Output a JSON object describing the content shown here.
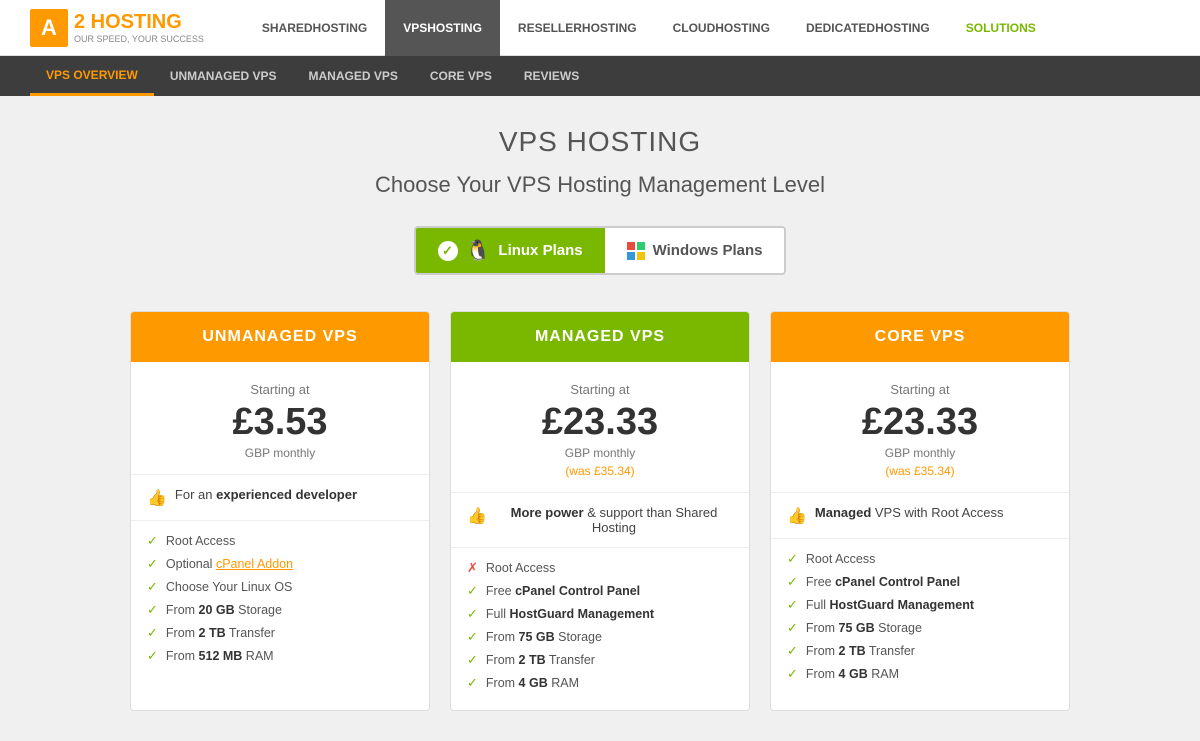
{
  "logo": {
    "letter": "A",
    "brand": "2 HOSTING",
    "tagline": "OUR SPEED, YOUR SUCCESS"
  },
  "main_nav": [
    {
      "label": "SHARED",
      "line2": "HOSTING",
      "active": false
    },
    {
      "label": "VPS",
      "line2": "HOSTING",
      "active": true
    },
    {
      "label": "RESELLER",
      "line2": "HOSTING",
      "active": false
    },
    {
      "label": "CLOUD",
      "line2": "HOSTING",
      "active": false
    },
    {
      "label": "DEDICATED",
      "line2": "HOSTING",
      "active": false
    },
    {
      "label": "SOLUTIONS",
      "line2": "",
      "active": false,
      "green": true
    }
  ],
  "sub_nav": [
    {
      "label": "VPS OVERVIEW",
      "active": true
    },
    {
      "label": "UNMANAGED VPS",
      "active": false
    },
    {
      "label": "MANAGED VPS",
      "active": false
    },
    {
      "label": "CORE VPS",
      "active": false
    },
    {
      "label": "REVIEWS",
      "active": false
    }
  ],
  "page": {
    "title": "VPS HOSTING",
    "subtitle": "Choose Your VPS Hosting Management Level"
  },
  "toggle": {
    "linux_label": "Linux Plans",
    "windows_label": "Windows Plans",
    "linux_active": true
  },
  "plans": [
    {
      "name": "UNMANAGED VPS",
      "header_class": "header-yellow",
      "starting_at": "Starting at",
      "price": "£3.53",
      "period": "GBP monthly",
      "was": null,
      "highlight": "For an experienced developer",
      "features": [
        {
          "icon": "check",
          "text": "Root Access",
          "bold": false
        },
        {
          "icon": "check",
          "text": "Optional ",
          "bold_part": "cPanel Addon",
          "rest": ""
        },
        {
          "icon": "check",
          "text": "Choose Your Linux OS",
          "bold": false
        },
        {
          "icon": "check",
          "text": "From ",
          "bold_part": "20 GB",
          "rest": " Storage"
        },
        {
          "icon": "check",
          "text": "From ",
          "bold_part": "2 TB",
          "rest": " Transfer"
        },
        {
          "icon": "check",
          "text": "From ",
          "bold_part": "512 MB",
          "rest": " RAM"
        }
      ]
    },
    {
      "name": "MANAGED VPS",
      "header_class": "header-green",
      "starting_at": "Starting at",
      "price": "£23.33",
      "period": "GBP monthly",
      "was": "(was £35.34)",
      "highlight": "More power & support than Shared Hosting",
      "features": [
        {
          "icon": "x",
          "text": "Root Access",
          "bold": false
        },
        {
          "icon": "check",
          "text": "Free ",
          "bold_part": "cPanel Control Panel",
          "rest": ""
        },
        {
          "icon": "check",
          "text": "Full ",
          "bold_part": "HostGuard Management",
          "rest": ""
        },
        {
          "icon": "check",
          "text": "From ",
          "bold_part": "75 GB",
          "rest": " Storage"
        },
        {
          "icon": "check",
          "text": "From ",
          "bold_part": "2 TB",
          "rest": " Transfer"
        },
        {
          "icon": "check",
          "text": "From ",
          "bold_part": "4 GB",
          "rest": " RAM"
        }
      ]
    },
    {
      "name": "CORE VPS",
      "header_class": "header-orange",
      "starting_at": "Starting at",
      "price": "£23.33",
      "period": "GBP monthly",
      "was": "(was £35.34)",
      "highlight": "Managed VPS with Root Access",
      "features": [
        {
          "icon": "check",
          "text": "Root Access",
          "bold": false
        },
        {
          "icon": "check",
          "text": "Free ",
          "bold_part": "cPanel Control Panel",
          "rest": ""
        },
        {
          "icon": "check",
          "text": "Full ",
          "bold_part": "HostGuard Management",
          "rest": ""
        },
        {
          "icon": "check",
          "text": "From ",
          "bold_part": "75 GB",
          "rest": " Storage"
        },
        {
          "icon": "check",
          "text": "From ",
          "bold_part": "2 TB",
          "rest": " Transfer"
        },
        {
          "icon": "check",
          "text": "From ",
          "bold_part": "4 GB",
          "rest": " RAM"
        }
      ]
    }
  ]
}
